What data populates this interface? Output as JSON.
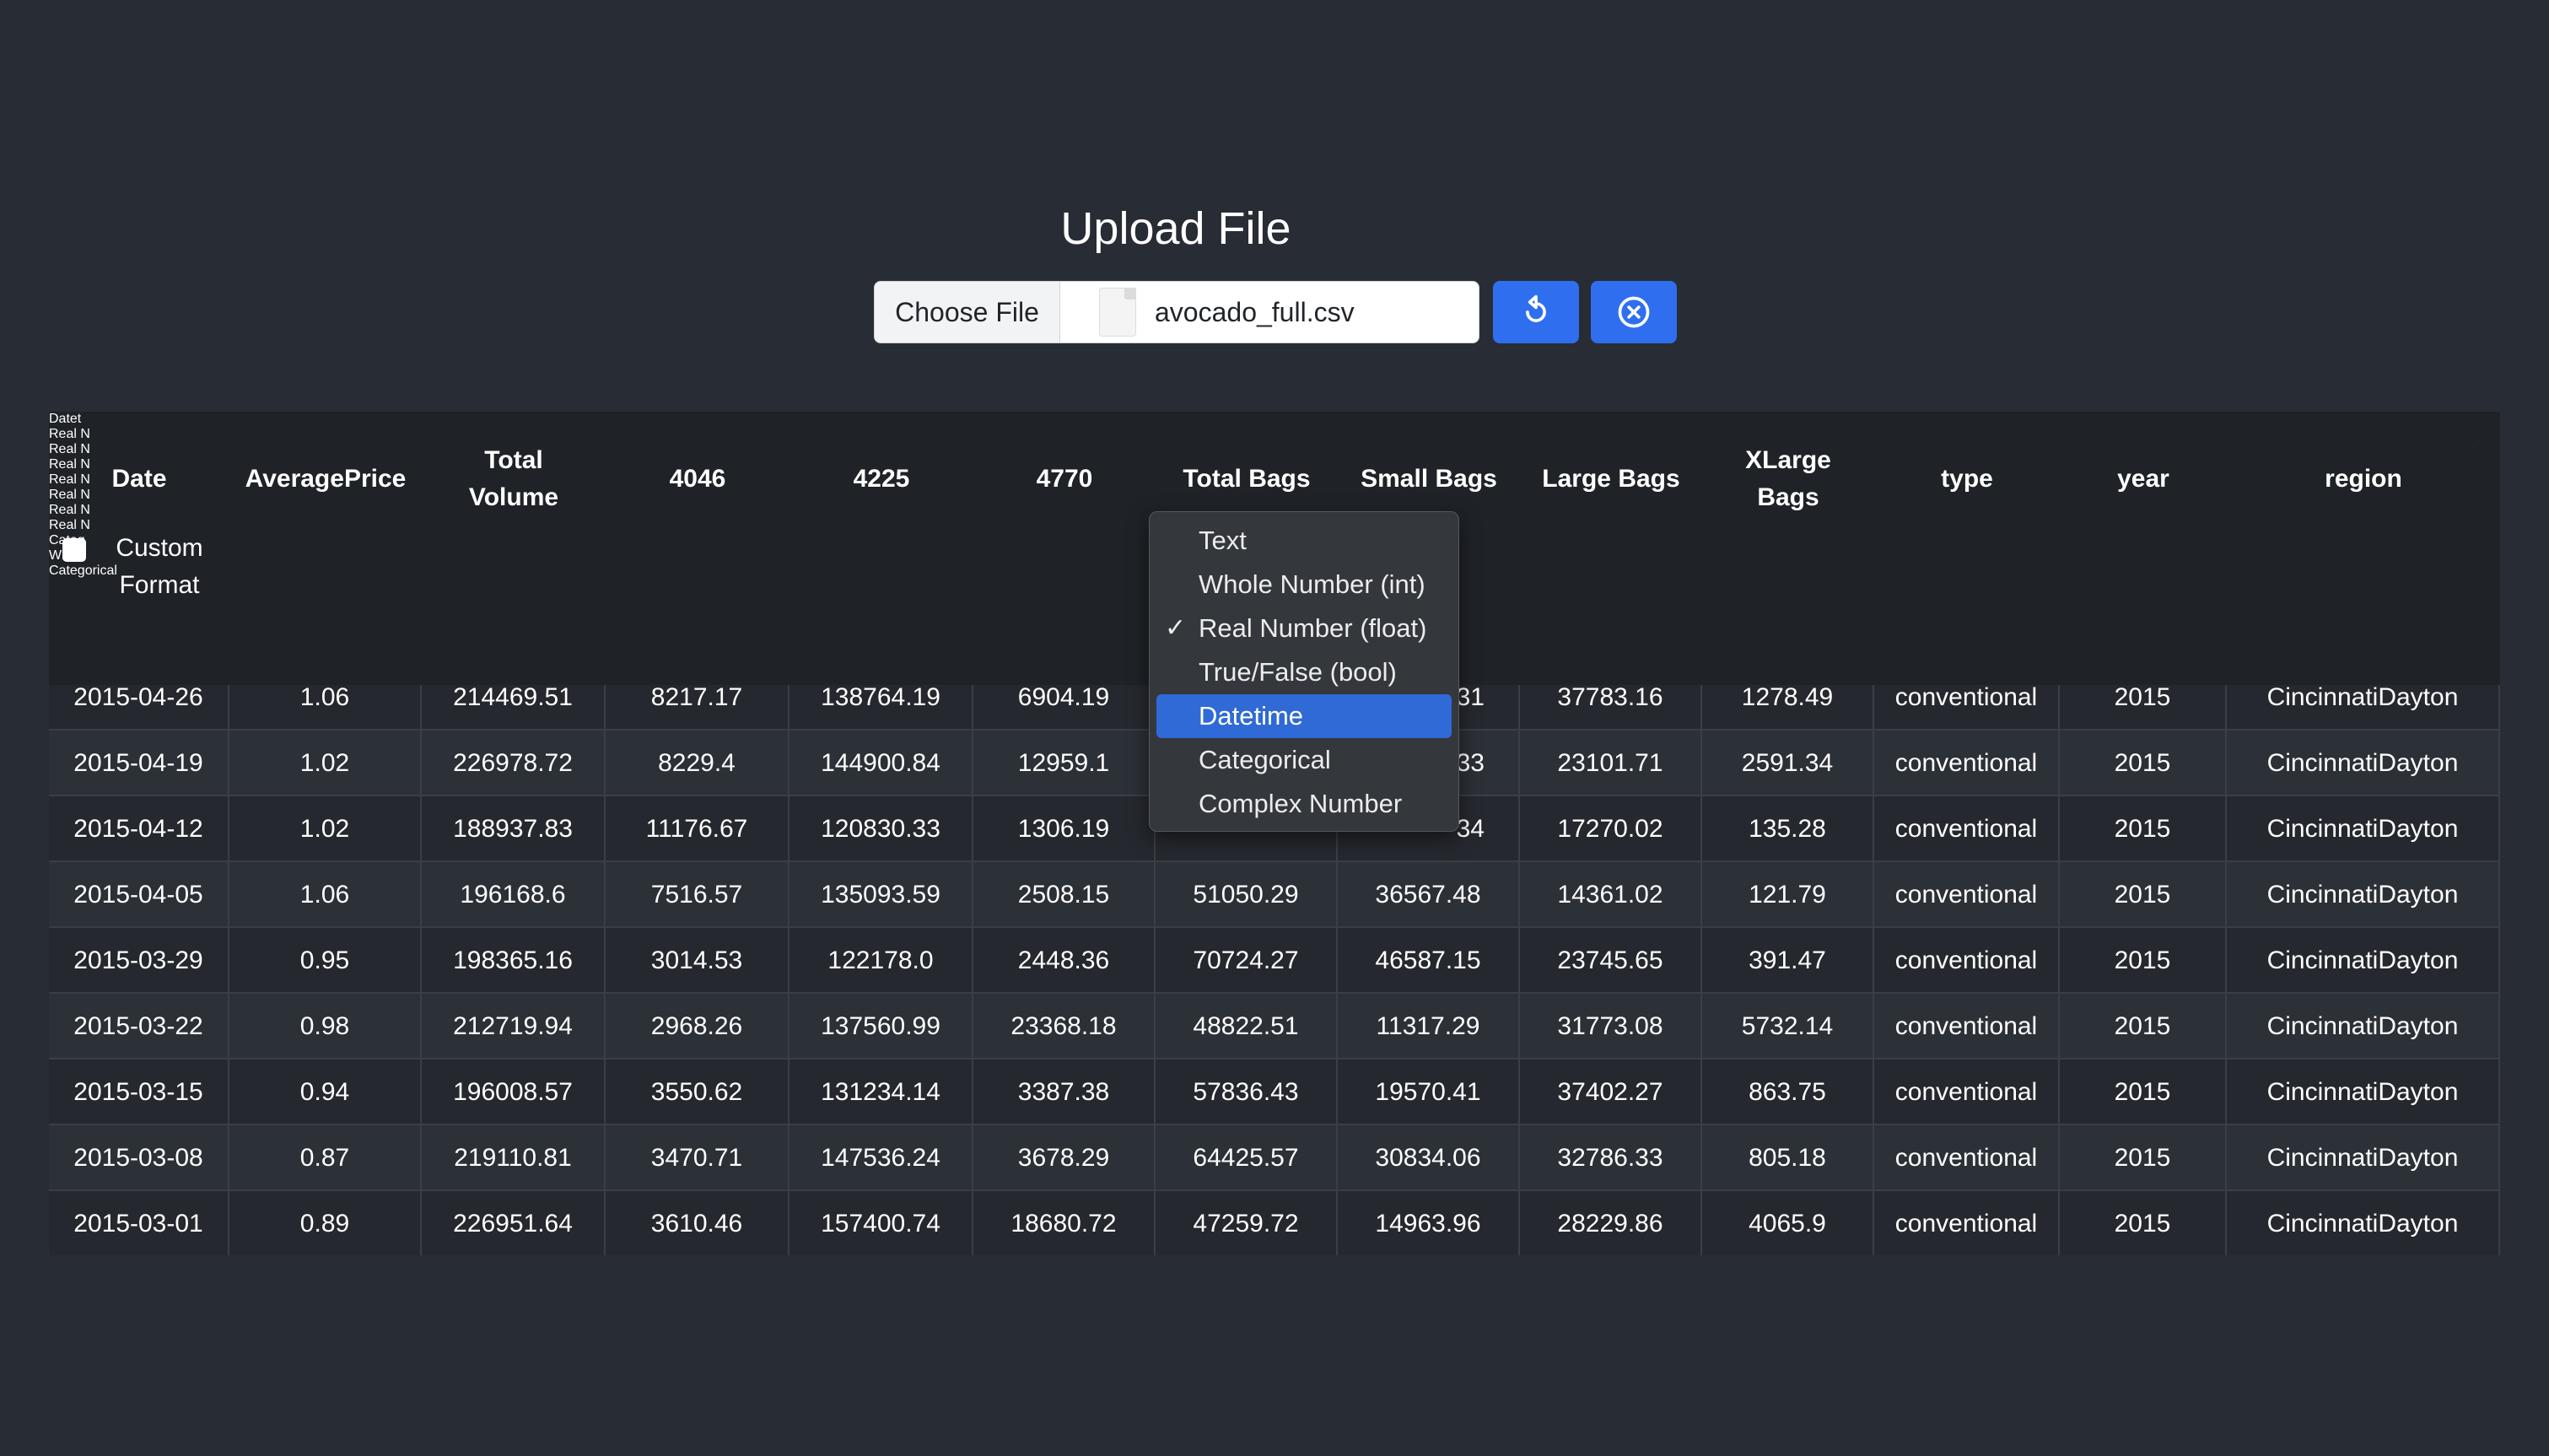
{
  "upload": {
    "title": "Upload File",
    "choose_label": "Choose File",
    "file_name": "avocado_full.csv"
  },
  "buttons": {
    "reset_icon": "refresh-icon",
    "clear_icon": "close-circle-icon",
    "accent": "#2f6fef"
  },
  "custom_format_label": "Custom Format",
  "columns": [
    {
      "header": "Date",
      "type": "Datet"
    },
    {
      "header": "AveragePrice",
      "type": "Real N"
    },
    {
      "header": "Total Volume",
      "type": "Real N"
    },
    {
      "header": "4046",
      "type": "Real N"
    },
    {
      "header": "4225",
      "type": "Real N"
    },
    {
      "header": "4770",
      "type": "Real N"
    },
    {
      "header": "Total Bags",
      "type": ""
    },
    {
      "header": "Small Bags",
      "type": ""
    },
    {
      "header": "Large Bags",
      "type": "Real N"
    },
    {
      "header": "XLarge Bags",
      "type": "Real N"
    },
    {
      "header": "type",
      "type": "Categ"
    },
    {
      "header": "year",
      "type": "Who"
    },
    {
      "header": "region",
      "type": "Categorical"
    }
  ],
  "rows": [
    [
      "2015-04-26",
      "1.06",
      "214469.51",
      "8217.17",
      "138764.19",
      "6904.19",
      "",
      "",
      "37783.16",
      "1278.49",
      "conventional",
      "2015",
      "CincinnatiDayton"
    ],
    [
      "2015-04-19",
      "1.02",
      "226978.72",
      "8229.4",
      "144900.84",
      "12959.1",
      "",
      "",
      "23101.71",
      "2591.34",
      "conventional",
      "2015",
      "CincinnatiDayton"
    ],
    [
      "2015-04-12",
      "1.02",
      "188937.83",
      "11176.67",
      "120830.33",
      "1306.19",
      "",
      "",
      "17270.02",
      "135.28",
      "conventional",
      "2015",
      "CincinnatiDayton"
    ],
    [
      "2015-04-05",
      "1.06",
      "196168.6",
      "7516.57",
      "135093.59",
      "2508.15",
      "51050.29",
      "36567.48",
      "14361.02",
      "121.79",
      "conventional",
      "2015",
      "CincinnatiDayton"
    ],
    [
      "2015-03-29",
      "0.95",
      "198365.16",
      "3014.53",
      "122178.0",
      "2448.36",
      "70724.27",
      "46587.15",
      "23745.65",
      "391.47",
      "conventional",
      "2015",
      "CincinnatiDayton"
    ],
    [
      "2015-03-22",
      "0.98",
      "212719.94",
      "2968.26",
      "137560.99",
      "23368.18",
      "48822.51",
      "11317.29",
      "31773.08",
      "5732.14",
      "conventional",
      "2015",
      "CincinnatiDayton"
    ],
    [
      "2015-03-15",
      "0.94",
      "196008.57",
      "3550.62",
      "131234.14",
      "3387.38",
      "57836.43",
      "19570.41",
      "37402.27",
      "863.75",
      "conventional",
      "2015",
      "CincinnatiDayton"
    ],
    [
      "2015-03-08",
      "0.87",
      "219110.81",
      "3470.71",
      "147536.24",
      "3678.29",
      "64425.57",
      "30834.06",
      "32786.33",
      "805.18",
      "conventional",
      "2015",
      "CincinnatiDayton"
    ],
    [
      "2015-03-01",
      "0.89",
      "226951.64",
      "3610.46",
      "157400.74",
      "18680.72",
      "47259.72",
      "14963.96",
      "28229.86",
      "4065.9",
      "conventional",
      "2015",
      "CincinnatiDayton"
    ]
  ],
  "partial_cells": {
    "r0c7": "31",
    "r1c7": "33",
    "r2c7": "34"
  },
  "menu": {
    "items": [
      "Text",
      "Whole Number (int)",
      "Real Number (float)",
      "True/False (bool)",
      "Datetime",
      "Categorical",
      "Complex Number"
    ],
    "checked_index": 2,
    "highlighted_index": 4,
    "check_mark": "✓"
  }
}
